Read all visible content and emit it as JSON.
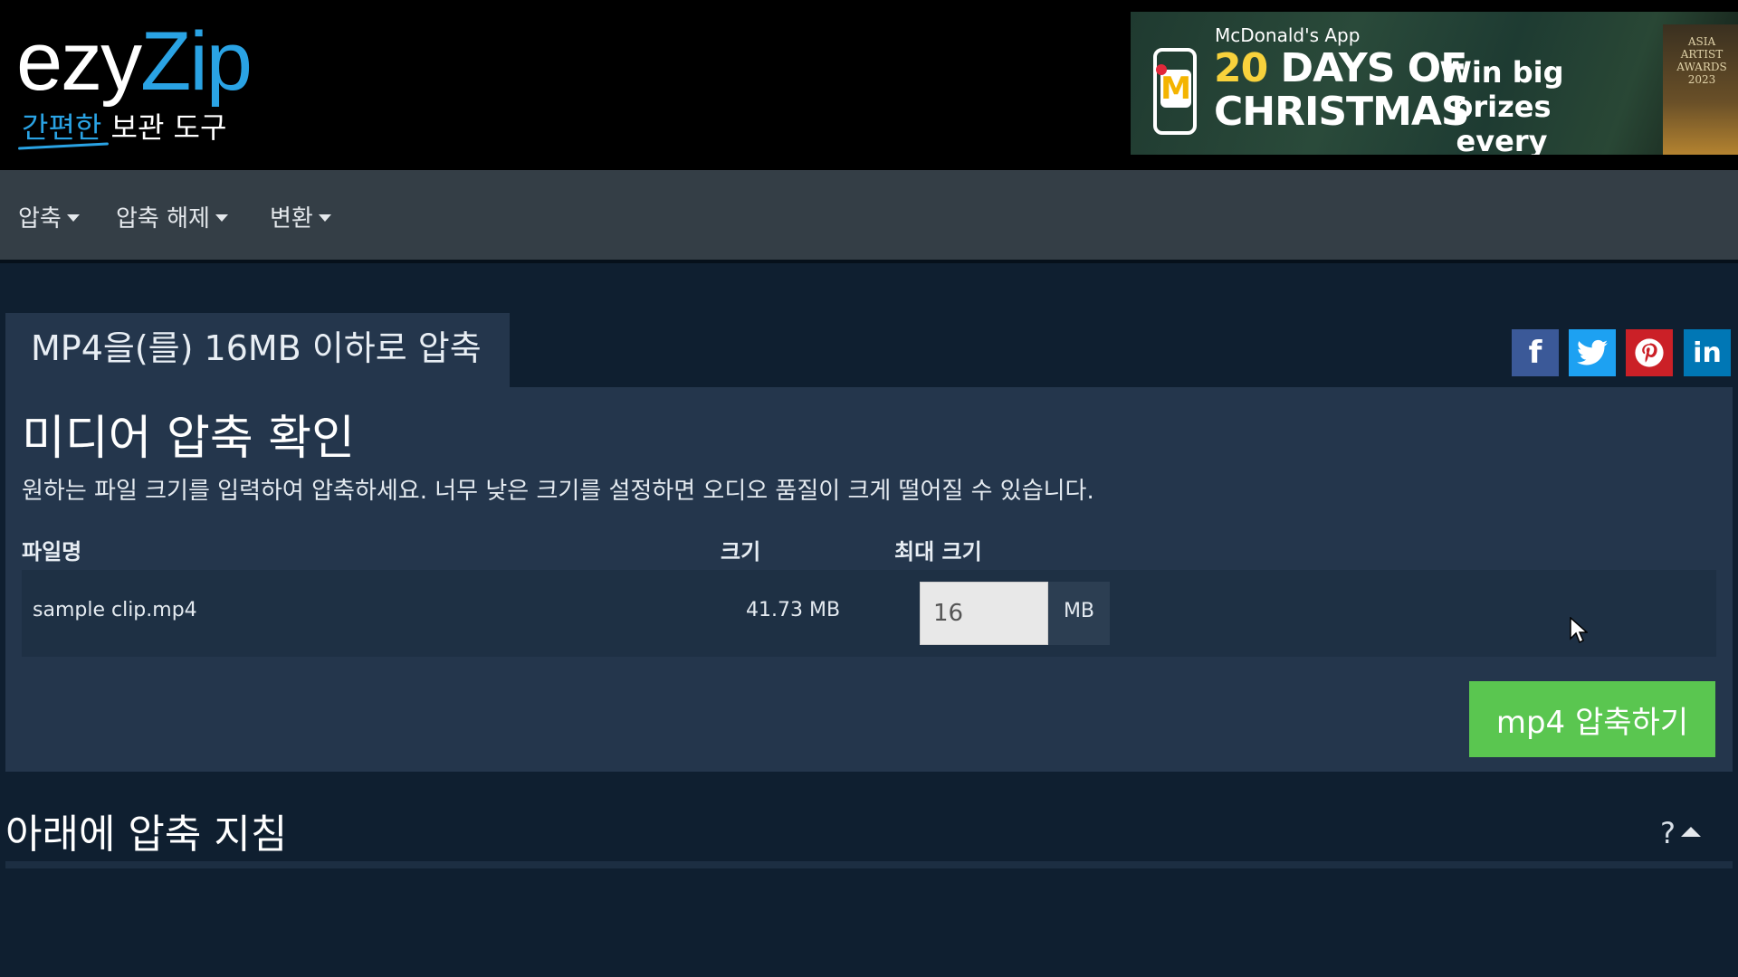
{
  "logo": {
    "main_a": "ezy",
    "main_b": "Zip",
    "sub_highlight": "간편한",
    "sub_rest": " 보관 도구"
  },
  "ad": {
    "app": "McDonald's App",
    "days_num": "20",
    "days_text": " DAYS OF",
    "christmas": "CHRISTMAS",
    "win": "Win big prizes every week!",
    "award": "ASIA ARTIST AWARDS 2023",
    "logo_letter": "M"
  },
  "nav": {
    "items": [
      {
        "label": "압축"
      },
      {
        "label": "압축 해제"
      },
      {
        "label": "변환"
      }
    ]
  },
  "tab": {
    "title": "MP4을(를) 16MB 이하로 압축"
  },
  "share": {
    "facebook": "f",
    "linkedin": "in"
  },
  "panel": {
    "title": "미디어 압축 확인",
    "description": "원하는 파일 크기를 입력하여 압축하세요. 너무 낮은 크기를 설정하면 오디오 품질이 크게 떨어질 수 있습니다.",
    "headers": {
      "filename": "파일명",
      "size": "크기",
      "max_size": "최대 크기"
    },
    "file": {
      "name": "sample clip.mp4",
      "size": "41.73 MB",
      "max_size_value": "16",
      "unit": "MB"
    },
    "compress_button": "mp4 압축하기"
  },
  "instructions": {
    "title": "아래에 압축 지침",
    "help": "?"
  },
  "colors": {
    "accent_blue": "#2aa3e4",
    "button_green": "#5ac650",
    "panel_bg": "#24364c",
    "page_bg": "#0f1f30"
  }
}
